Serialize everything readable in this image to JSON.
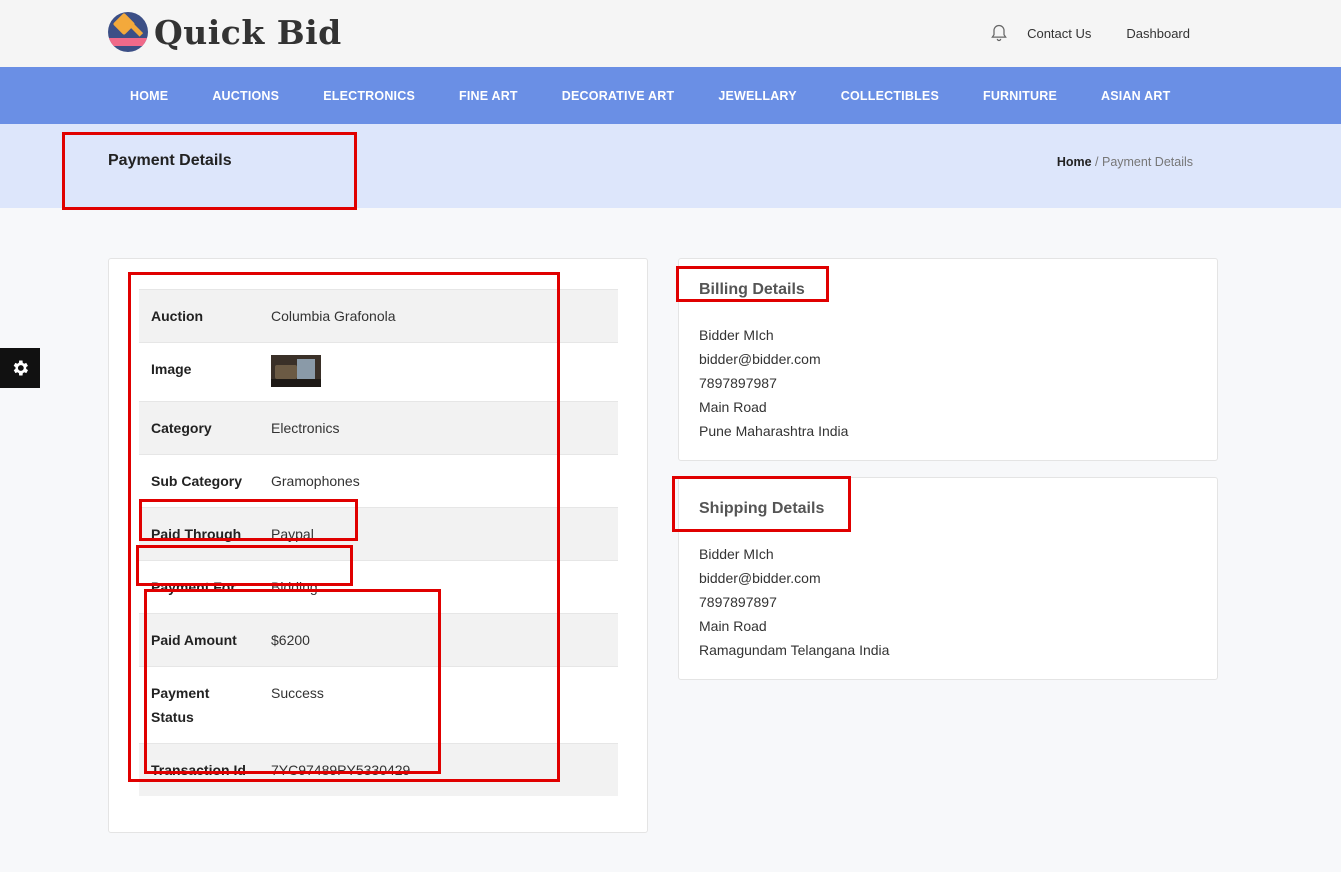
{
  "brand": {
    "name": "Quick Bid"
  },
  "top_links": {
    "contact": "Contact Us",
    "dashboard": "Dashboard"
  },
  "nav": {
    "items": [
      "HOME",
      "AUCTIONS",
      "ELECTRONICS",
      "FINE ART",
      "DECORATIVE ART",
      "JEWELLARY",
      "COLLECTIBLES",
      "FURNITURE",
      "ASIAN ART"
    ]
  },
  "page": {
    "title": "Payment Details",
    "breadcrumb_home": "Home",
    "breadcrumb_sep": " / ",
    "breadcrumb_current": "Payment Details"
  },
  "details": {
    "auction_label": "Auction",
    "auction": "Columbia Grafonola",
    "image_label": "Image",
    "category_label": "Category",
    "category": "Electronics",
    "subcategory_label": "Sub Category",
    "subcategory": "Gramophones",
    "paid_through_label": "Paid Through",
    "paid_through": "Paypal",
    "payment_for_label": "Payment For",
    "payment_for": "Bidding",
    "paid_amount_label": "Paid Amount",
    "paid_amount": "$6200",
    "payment_status_label": "Payment Status",
    "payment_status": "Success",
    "transaction_id_label": "Transaction Id",
    "transaction_id": "7YC97489PY5330429"
  },
  "billing": {
    "heading": "Billing Details",
    "name": "Bidder MIch",
    "email": "bidder@bidder.com",
    "phone": "7897897987",
    "street": "Main Road",
    "city_line": "Pune Maharashtra India"
  },
  "shipping": {
    "heading": "Shipping Details",
    "name": "Bidder MIch",
    "email": "bidder@bidder.com",
    "phone": "7897897897",
    "street": "Main Road",
    "city_line": "Ramagundam Telangana India"
  },
  "colors": {
    "nav": "#6a8fe5",
    "title_band": "#dde6fb",
    "annotation": "#e00000"
  },
  "icons": {
    "bell": "bell-icon",
    "settings": "gear-icon"
  }
}
